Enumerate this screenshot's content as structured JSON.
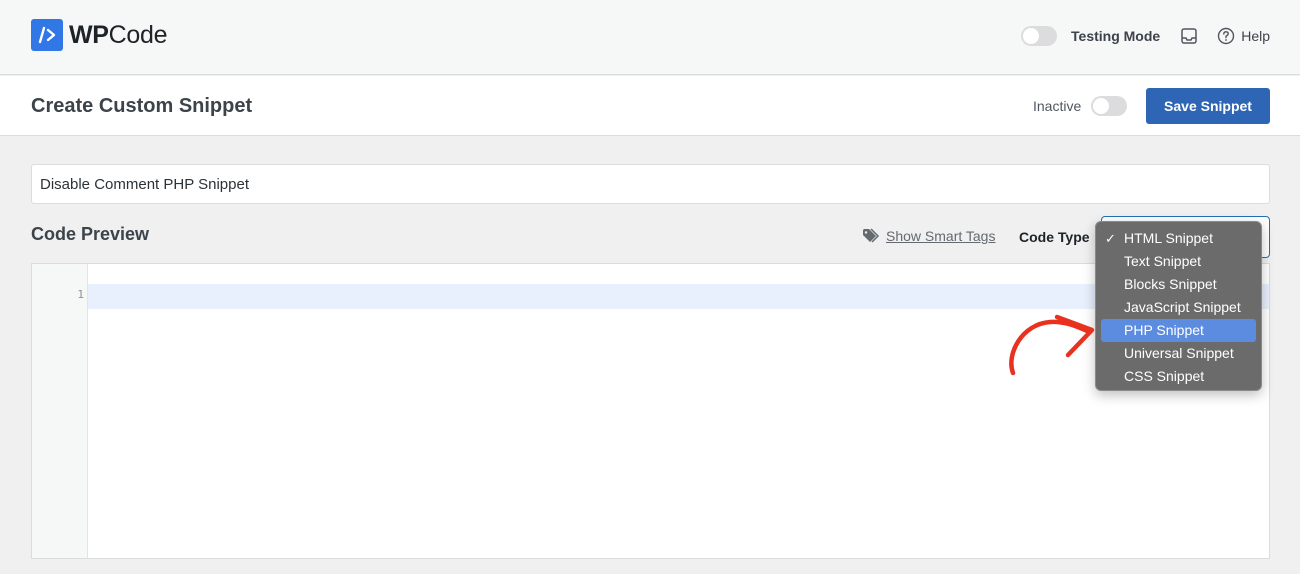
{
  "topbar": {
    "logo": {
      "bold": "WP",
      "rest": "Code"
    },
    "testing_mode_label": "Testing Mode",
    "testing_mode_on": false,
    "help_label": "Help"
  },
  "header": {
    "title": "Create Custom Snippet",
    "status_label": "Inactive",
    "active": false,
    "save_label": "Save Snippet"
  },
  "snippet": {
    "title_value": "Disable Comment PHP Snippet"
  },
  "code_preview": {
    "label": "Code Preview",
    "smart_tags_label": "Show Smart Tags",
    "code_type_label": "Code Type"
  },
  "editor": {
    "line_numbers": [
      "1"
    ]
  },
  "code_type_dropdown": {
    "check_mark": "✓",
    "options": [
      {
        "label": "HTML Snippet",
        "checked": true,
        "highlighted": false
      },
      {
        "label": "Text Snippet",
        "checked": false,
        "highlighted": false
      },
      {
        "label": "Blocks Snippet",
        "checked": false,
        "highlighted": false
      },
      {
        "label": "JavaScript Snippet",
        "checked": false,
        "highlighted": false
      },
      {
        "label": "PHP Snippet",
        "checked": false,
        "highlighted": true
      },
      {
        "label": "Universal Snippet",
        "checked": false,
        "highlighted": false
      },
      {
        "label": "CSS Snippet",
        "checked": false,
        "highlighted": false
      }
    ]
  },
  "colors": {
    "brand_blue": "#3177e5",
    "save_button": "#2e66b5",
    "highlight": "#5b8ce0",
    "annotation_arrow": "#e8321f"
  }
}
